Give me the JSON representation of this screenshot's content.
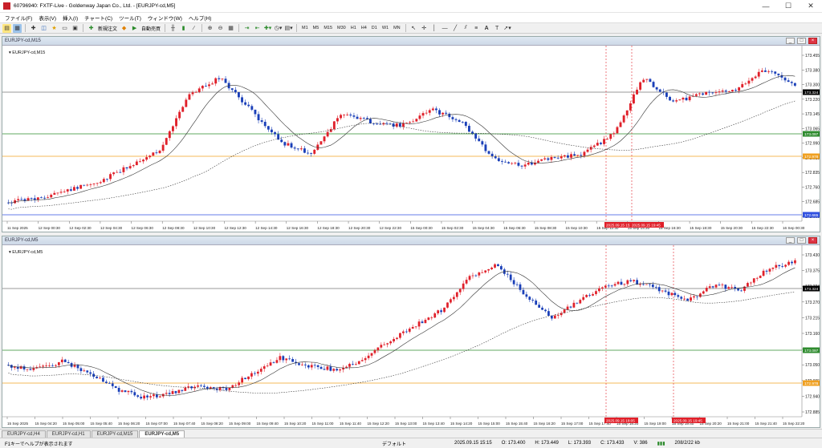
{
  "window": {
    "title": "60796940: FXTF-Live - Goldenway Japan Co., Ltd. - [EURJPY-cd,M5]"
  },
  "menu": [
    "ファイル(F)",
    "表示(V)",
    "挿入(I)",
    "チャート(C)",
    "ツール(T)",
    "ウィンドウ(W)",
    "ヘルプ(H)"
  ],
  "toolbar": {
    "new_order": "新規注文",
    "auto_trade": "自動売買",
    "timeframes": [
      "M1",
      "M5",
      "M15",
      "M30",
      "H1",
      "H4",
      "D1",
      "W1",
      "MN"
    ]
  },
  "charts": [
    {
      "title": "EURJPY-cd,M15",
      "label": "EURJPY-cd,M15",
      "y_ticks": [
        "173.455",
        "173.380",
        "173.300",
        "173.220",
        "173.145",
        "173.065",
        "172.990",
        "172.915",
        "172.835",
        "172.760",
        "172.685",
        "172.605"
      ],
      "x_ticks": [
        "11 Sep 2025",
        "12 Sep 00:30",
        "12 Sep 02:30",
        "12 Sep 04:30",
        "12 Sep 06:30",
        "12 Sep 08:30",
        "12 Sep 10:30",
        "12 Sep 12:30",
        "12 Sep 14:30",
        "12 Sep 16:30",
        "12 Sep 18:30",
        "12 Sep 20:30",
        "12 Sep 22:30",
        "15 Sep 00:30",
        "15 Sep 02:30",
        "15 Sep 04:30",
        "15 Sep 06:30",
        "15 Sep 08:30",
        "15 Sep 10:30",
        "15 Sep 12:30",
        "15 Sep 14:30",
        "15 Sep 16:30",
        "15 Sep 18:30",
        "15 Sep 20:30",
        "15 Sep 22:30",
        "16 Sep 00:30"
      ],
      "levels": [
        {
          "value": "173.324",
          "color": "#000000",
          "bg": "#000000"
        },
        {
          "value": "173.097",
          "color": "#2e8b2e",
          "bg": "#2e8b2e"
        },
        {
          "value": "172.978",
          "color": "#f0a020",
          "bg": "#f0a020"
        },
        {
          "value": "172.665",
          "color": "#3050e0",
          "bg": "#3050e0"
        }
      ],
      "vline_labels": [
        "2025.09.15 15:15",
        "2025.09.15 19:45"
      ]
    },
    {
      "title": "EURJPY-cd,M5",
      "label": "EURJPY-cd,M5",
      "y_ticks": [
        "173.430",
        "173.375",
        "173.324",
        "173.270",
        "173.215",
        "173.160",
        "173.105",
        "173.050",
        "172.995",
        "172.940",
        "172.885"
      ],
      "x_ticks": [
        "15 Sep 2025",
        "15 Sep 04:20",
        "15 Sep 05:00",
        "15 Sep 05:40",
        "15 Sep 06:20",
        "15 Sep 07:00",
        "15 Sep 07:40",
        "15 Sep 08:20",
        "15 Sep 09:00",
        "15 Sep 09:40",
        "15 Sep 10:20",
        "15 Sep 11:00",
        "15 Sep 11:40",
        "15 Sep 12:20",
        "15 Sep 13:00",
        "15 Sep 13:40",
        "15 Sep 14:20",
        "15 Sep 15:00",
        "15 Sep 15:40",
        "15 Sep 16:20",
        "15 Sep 17:00",
        "15 Sep 17:40",
        "15 Sep 18:20",
        "15 Sep 19:00",
        "15 Sep 19:40",
        "15 Sep 20:20",
        "15 Sep 21:00",
        "15 Sep 21:40",
        "15 Sep 22:20"
      ],
      "levels": [
        {
          "value": "173.324",
          "color": "#000000",
          "bg": "#000000"
        },
        {
          "value": "173.097",
          "color": "#2e8b2e",
          "bg": "#2e8b2e"
        },
        {
          "value": "172.978",
          "color": "#f0a020",
          "bg": "#f0a020"
        }
      ],
      "vline_labels": [
        "2025.09.15 18:05",
        "2025.09.15 19:45"
      ]
    }
  ],
  "tabs": [
    "EURJPY-cd,H4",
    "EURJPY-cd,H1",
    "EURJPY-cd,M15",
    "EURJPY-cd,M5"
  ],
  "status": {
    "help": "F1キーでヘルプが表示されます",
    "profile": "デフォルト",
    "time": "2025.09.15 15:15",
    "open": "O: 173.400",
    "high": "H: 173.449",
    "low": "L: 173.393",
    "close": "C: 173.433",
    "volume": "V: 386",
    "traffic": "208/2/22 kb"
  },
  "colors": {
    "bull": "#e0202a",
    "bear": "#1a3fb8"
  }
}
